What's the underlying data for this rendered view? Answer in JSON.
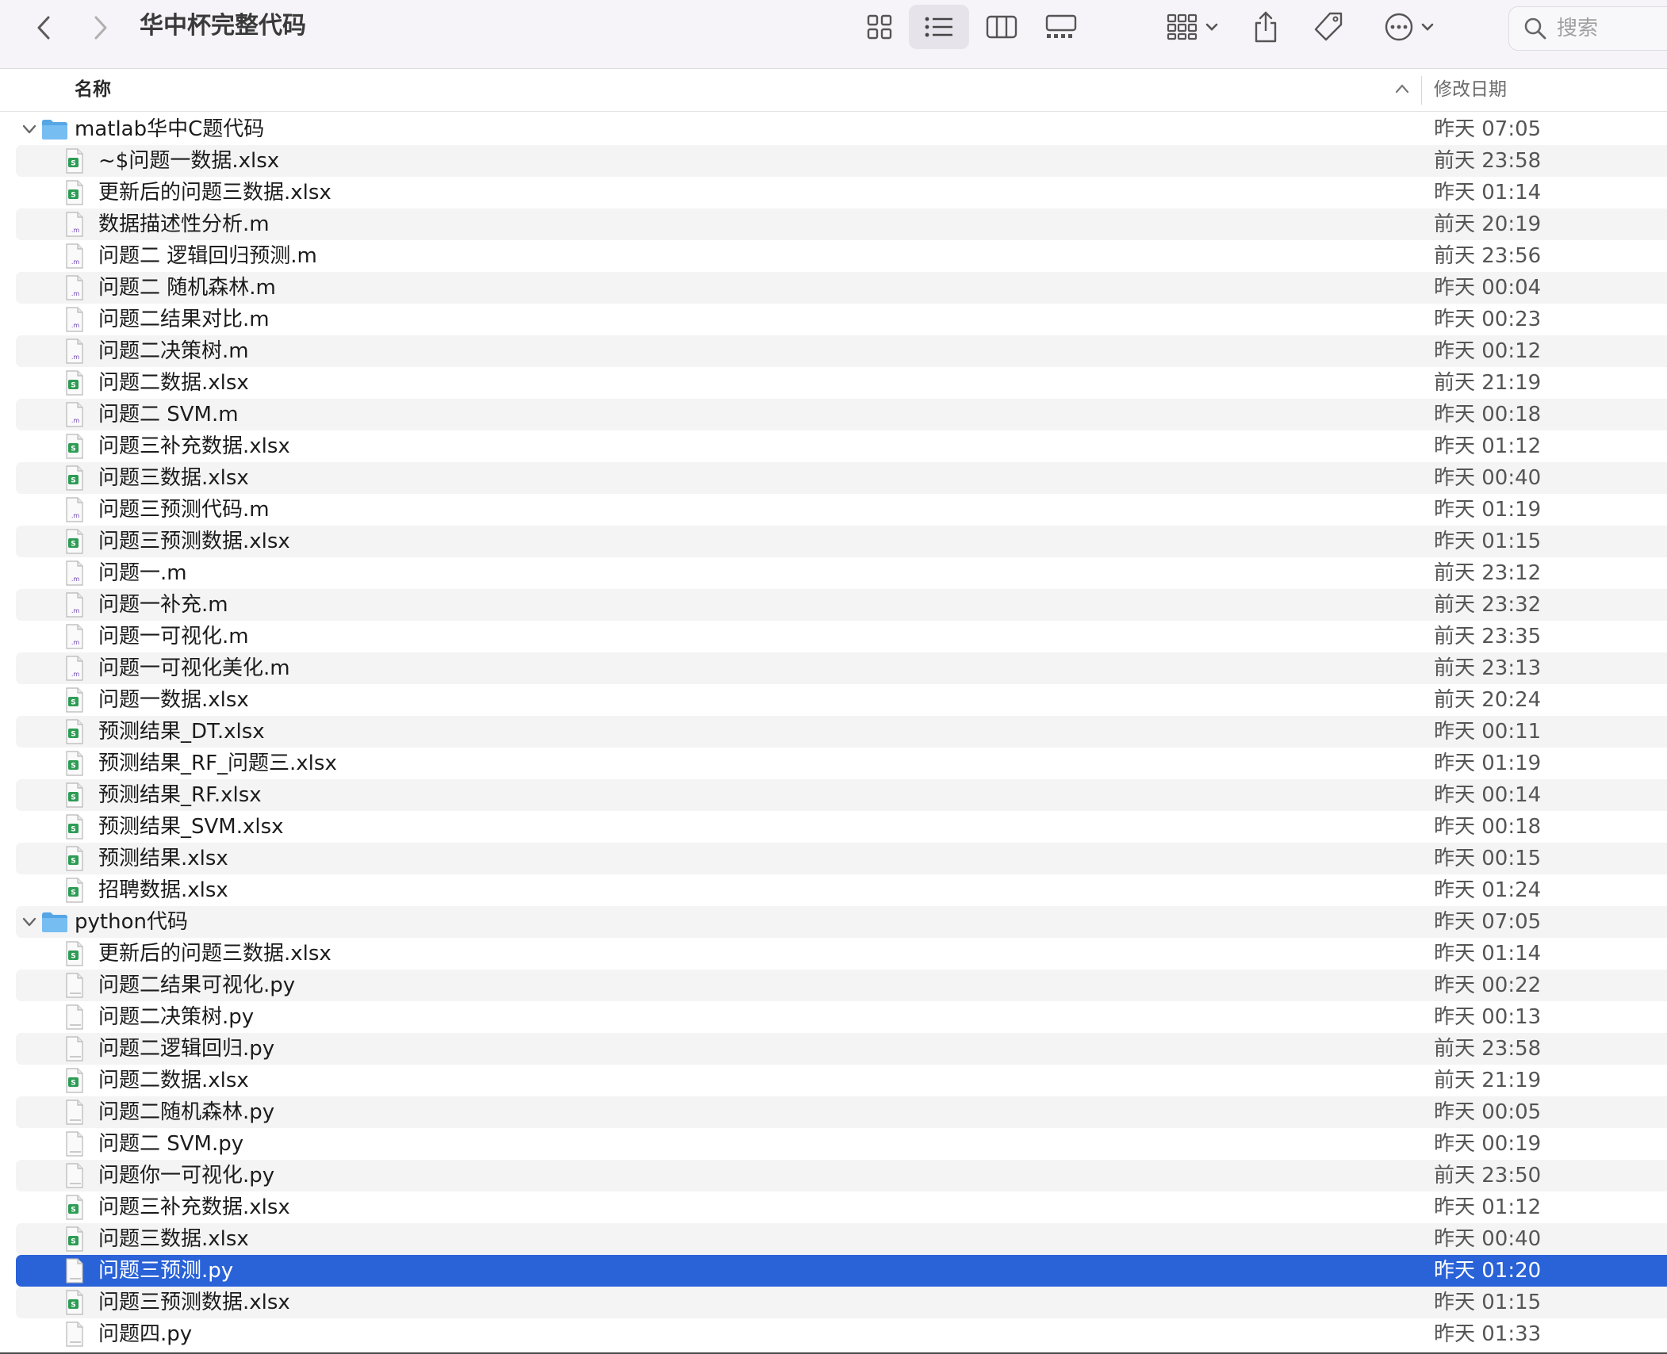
{
  "toolbar": {
    "title": "华中杯完整代码",
    "search_placeholder": "搜索"
  },
  "columns": {
    "name": "名称",
    "date": "修改日期"
  },
  "rows": [
    {
      "kind": "folder",
      "name": "matlab华中C题代码",
      "date": "昨天 07:05"
    },
    {
      "kind": "file",
      "type": "xlsx",
      "name": "~$问题一数据.xlsx",
      "date": "前天 23:58"
    },
    {
      "kind": "file",
      "type": "xlsx",
      "name": "更新后的问题三数据.xlsx",
      "date": "昨天 01:14"
    },
    {
      "kind": "file",
      "type": "m",
      "name": "数据描述性分析.m",
      "date": "前天 20:19"
    },
    {
      "kind": "file",
      "type": "m",
      "name": "问题二 逻辑回归预测.m",
      "date": "前天 23:56"
    },
    {
      "kind": "file",
      "type": "m",
      "name": "问题二 随机森林.m",
      "date": "昨天 00:04"
    },
    {
      "kind": "file",
      "type": "m",
      "name": "问题二结果对比.m",
      "date": "昨天 00:23"
    },
    {
      "kind": "file",
      "type": "m",
      "name": "问题二决策树.m",
      "date": "昨天 00:12"
    },
    {
      "kind": "file",
      "type": "xlsx",
      "name": "问题二数据.xlsx",
      "date": "前天 21:19"
    },
    {
      "kind": "file",
      "type": "m",
      "name": "问题二 SVM.m",
      "date": "昨天 00:18"
    },
    {
      "kind": "file",
      "type": "xlsx",
      "name": "问题三补充数据.xlsx",
      "date": "昨天 01:12"
    },
    {
      "kind": "file",
      "type": "xlsx",
      "name": "问题三数据.xlsx",
      "date": "昨天 00:40"
    },
    {
      "kind": "file",
      "type": "m",
      "name": "问题三预测代码.m",
      "date": "昨天 01:19"
    },
    {
      "kind": "file",
      "type": "xlsx",
      "name": "问题三预测数据.xlsx",
      "date": "昨天 01:15"
    },
    {
      "kind": "file",
      "type": "m",
      "name": "问题一.m",
      "date": "前天 23:12"
    },
    {
      "kind": "file",
      "type": "m",
      "name": "问题一补充.m",
      "date": "前天 23:32"
    },
    {
      "kind": "file",
      "type": "m",
      "name": "问题一可视化.m",
      "date": "前天 23:35"
    },
    {
      "kind": "file",
      "type": "m",
      "name": "问题一可视化美化.m",
      "date": "前天 23:13"
    },
    {
      "kind": "file",
      "type": "xlsx",
      "name": "问题一数据.xlsx",
      "date": "前天 20:24"
    },
    {
      "kind": "file",
      "type": "xlsx",
      "name": "预测结果_DT.xlsx",
      "date": "昨天 00:11"
    },
    {
      "kind": "file",
      "type": "xlsx",
      "name": "预测结果_RF_问题三.xlsx",
      "date": "昨天 01:19"
    },
    {
      "kind": "file",
      "type": "xlsx",
      "name": "预测结果_RF.xlsx",
      "date": "昨天 00:14"
    },
    {
      "kind": "file",
      "type": "xlsx",
      "name": "预测结果_SVM.xlsx",
      "date": "昨天 00:18"
    },
    {
      "kind": "file",
      "type": "xlsx",
      "name": "预测结果.xlsx",
      "date": "昨天 00:15"
    },
    {
      "kind": "file",
      "type": "xlsx",
      "name": "招聘数据.xlsx",
      "date": "昨天 01:24"
    },
    {
      "kind": "folder",
      "name": "python代码",
      "date": "昨天 07:05"
    },
    {
      "kind": "file",
      "type": "xlsx",
      "name": "更新后的问题三数据.xlsx",
      "date": "昨天 01:14"
    },
    {
      "kind": "file",
      "type": "py",
      "name": "问题二结果可视化.py",
      "date": "昨天 00:22"
    },
    {
      "kind": "file",
      "type": "py",
      "name": "问题二决策树.py",
      "date": "昨天 00:13"
    },
    {
      "kind": "file",
      "type": "py",
      "name": "问题二逻辑回归.py",
      "date": "前天 23:58"
    },
    {
      "kind": "file",
      "type": "xlsx",
      "name": "问题二数据.xlsx",
      "date": "前天 21:19"
    },
    {
      "kind": "file",
      "type": "py",
      "name": "问题二随机森林.py",
      "date": "昨天 00:05"
    },
    {
      "kind": "file",
      "type": "py",
      "name": "问题二 SVM.py",
      "date": "昨天 00:19"
    },
    {
      "kind": "file",
      "type": "py",
      "name": "问题你一可视化.py",
      "date": "前天 23:50"
    },
    {
      "kind": "file",
      "type": "xlsx",
      "name": "问题三补充数据.xlsx",
      "date": "昨天 01:12"
    },
    {
      "kind": "file",
      "type": "xlsx",
      "name": "问题三数据.xlsx",
      "date": "昨天 00:40"
    },
    {
      "kind": "file",
      "type": "py",
      "name": "问题三预测.py",
      "date": "昨天 01:20",
      "selected": true
    },
    {
      "kind": "file",
      "type": "xlsx",
      "name": "问题三预测数据.xlsx",
      "date": "昨天 01:15"
    },
    {
      "kind": "file",
      "type": "py",
      "name": "问题四.py",
      "date": "昨天 01:33"
    }
  ],
  "colors": {
    "selection": "#2a62d8",
    "folder": "#5aa8e8",
    "xlsx_icon": "#2e9c55",
    "m_icon": "#6a3fb0"
  }
}
